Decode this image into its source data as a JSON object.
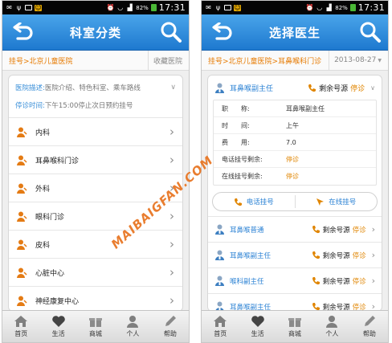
{
  "status_bar": {
    "battery": "82%",
    "time": "17:31"
  },
  "left": {
    "title": "科室分类",
    "breadcrumb": "挂号>北京儿童医院",
    "favorite": "收藏医院",
    "desc_label": "医院描述:",
    "desc_text": "医院介绍、特色科室、乘车路线",
    "stop_label": "停诊时间:",
    "stop_text": "下午15:00停止次日预约挂号",
    "departments": [
      "内科",
      "耳鼻喉科门诊",
      "外科",
      "眼科门诊",
      "皮科",
      "心脏中心",
      "神经康复中心"
    ]
  },
  "right": {
    "title": "选择医生",
    "breadcrumb": "挂号>北京儿童医院>耳鼻喉科门诊",
    "date": "2013-08-27",
    "expanded_doctor": {
      "name": "耳鼻喉副主任",
      "remain_label": "剩余号源",
      "status": "停诊",
      "details": [
        {
          "k": "职　　称:",
          "v": "耳鼻喉副主任",
          "orange": false
        },
        {
          "k": "时　　间:",
          "v": "上午",
          "orange": false
        },
        {
          "k": "费　　用:",
          "v": "7.0",
          "orange": false
        },
        {
          "k": "电话挂号剩余:",
          "v": "停诊",
          "orange": true
        },
        {
          "k": "在线挂号剩余:",
          "v": "停诊",
          "orange": true
        }
      ],
      "phone_btn": "电话挂号",
      "online_btn": "在线挂号"
    },
    "doctors": [
      {
        "name": "耳鼻喉普通",
        "remain_label": "剩余号源",
        "status": "停诊"
      },
      {
        "name": "耳鼻喉副主任",
        "remain_label": "剩余号源",
        "status": "停诊"
      },
      {
        "name": "喉科副主任",
        "remain_label": "剩余号源",
        "status": "停诊"
      },
      {
        "name": "耳鼻喉副主任",
        "remain_label": "剩余号源",
        "status": "停诊"
      }
    ]
  },
  "tabs": [
    "首页",
    "生活",
    "商城",
    "个人",
    "帮助"
  ],
  "watermark": "MAIBAIGFAN.COM",
  "colors": {
    "title_blue": "#2f8fdf",
    "accent_orange": "#e08500",
    "link_blue": "#2b82d4"
  }
}
